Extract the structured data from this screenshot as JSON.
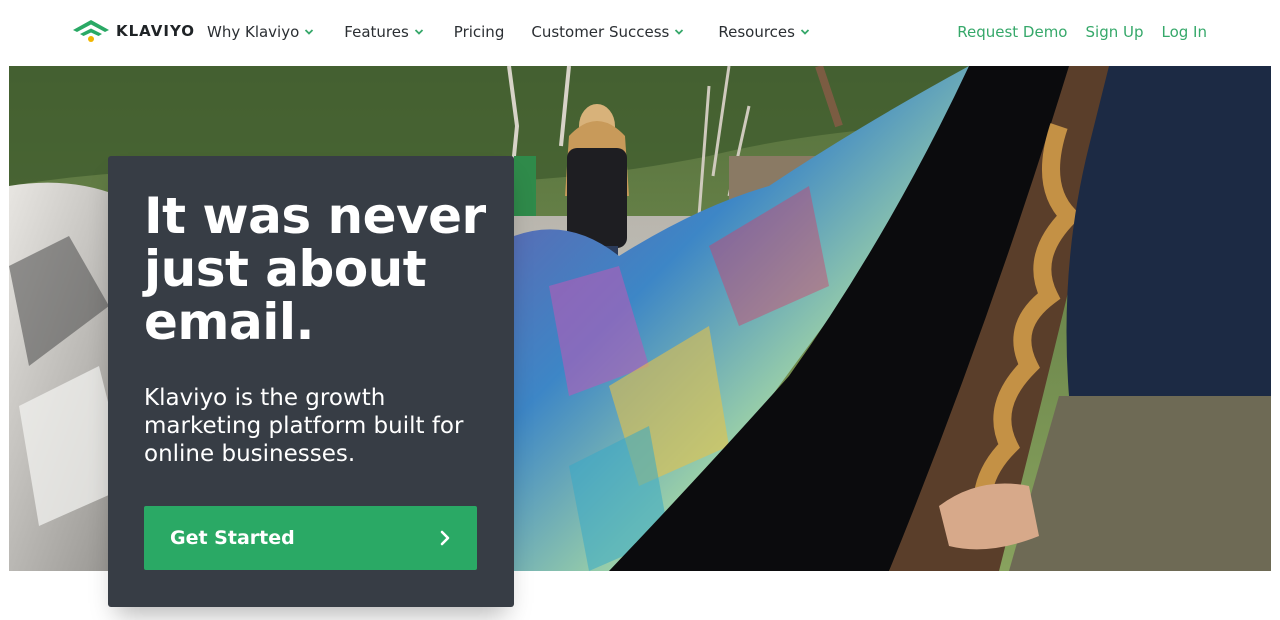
{
  "brand": {
    "name": "KLAVIYO",
    "logo_icon": "klaviyo-signal-icon",
    "accent_color": "#36a86a"
  },
  "nav": {
    "items": [
      {
        "label": "Why Klaviyo",
        "has_dropdown": true
      },
      {
        "label": "Features",
        "has_dropdown": true
      },
      {
        "label": "Pricing",
        "has_dropdown": false
      },
      {
        "label": "Customer Success",
        "has_dropdown": true
      },
      {
        "label": "Resources",
        "has_dropdown": true
      }
    ],
    "right_links": {
      "request_demo": "Request Demo",
      "sign_up": "Sign Up",
      "log_in": "Log In"
    }
  },
  "hero": {
    "headline": "It was never just about email.",
    "subheadline": "Klaviyo is the growth marketing platform built for online businesses.",
    "cta_label": "Get Started",
    "cta_icon": "chevron-right-icon",
    "cta_color": "#2aa965",
    "card_color": "#373d45"
  }
}
